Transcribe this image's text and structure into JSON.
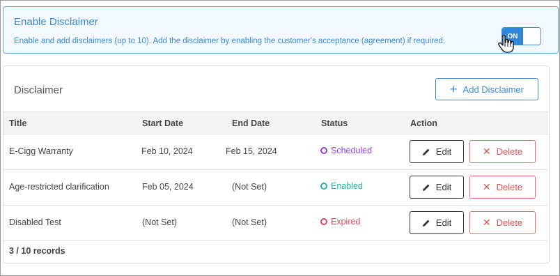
{
  "banner": {
    "title": "Enable Disclaimer",
    "description": "Enable and add disclaimers (up to 10). Add the disclaimer by enabling the customer's acceptance (agreement) if required.",
    "toggle_label": "ON",
    "toggle_state": "on"
  },
  "card": {
    "title": "Disclaimer",
    "add_button_label": "Add Disclaimer"
  },
  "table": {
    "columns": [
      "Title",
      "Start Date",
      "End Date",
      "Status",
      "Action"
    ],
    "rows": [
      {
        "title": "E-Cigg Warranty",
        "start_date": "Feb 10, 2024",
        "end_date": "Feb 15, 2024",
        "status": "Scheduled",
        "status_color": "#8e44ec"
      },
      {
        "title": "Age-restricted clarification",
        "start_date": "Feb 05, 2024",
        "end_date": "(Not Set)",
        "status": "Enabled",
        "status_color": "#1fb7a3"
      },
      {
        "title": "Disabled Test",
        "start_date": "(Not Set)",
        "end_date": "(Not Set)",
        "status": "Expired",
        "status_color": "#e8455f"
      }
    ],
    "edit_label": "Edit",
    "delete_label": "Delete"
  },
  "footer": {
    "records": "3 / 10 records"
  },
  "colors": {
    "accent": "#3a8ad6",
    "danger": "#d9534f"
  }
}
